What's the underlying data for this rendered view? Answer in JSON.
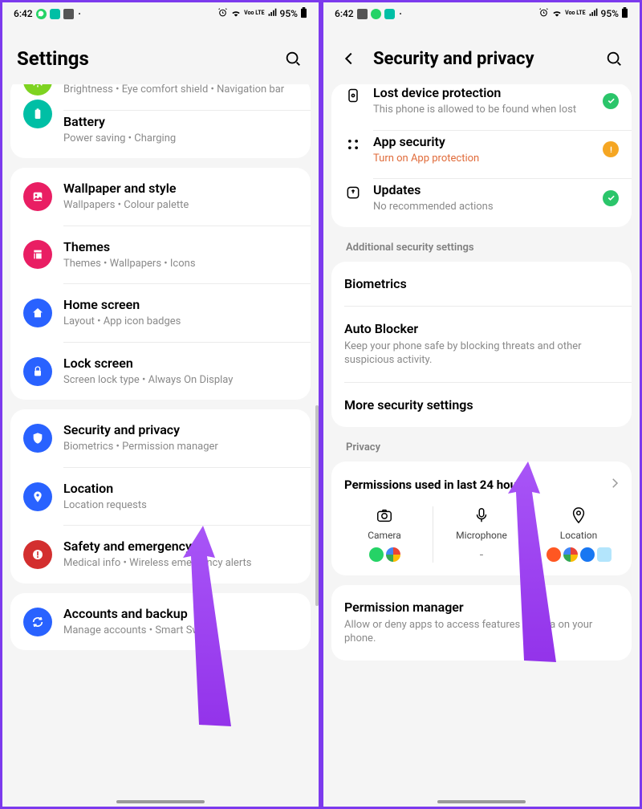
{
  "statusbar": {
    "time": "6:42",
    "battery": "95%",
    "network": "Voo LTE"
  },
  "left": {
    "header": "Settings",
    "partial": {
      "sub": "Brightness  •  Eye comfort shield  •  Navigation bar"
    },
    "card1": [
      {
        "title": "Battery",
        "sub": "Power saving  •  Charging"
      }
    ],
    "card2": [
      {
        "title": "Wallpaper and style",
        "sub": "Wallpapers  •  Colour palette"
      },
      {
        "title": "Themes",
        "sub": "Themes  •  Wallpapers  •  Icons"
      },
      {
        "title": "Home screen",
        "sub": "Layout  •  App icon badges"
      },
      {
        "title": "Lock screen",
        "sub": "Screen lock type  •  Always On Display"
      }
    ],
    "card3": [
      {
        "title": "Security and privacy",
        "sub": "Biometrics  •  Permission manager"
      },
      {
        "title": "Location",
        "sub": "Location requests"
      },
      {
        "title": "Safety and emergency",
        "sub": "Medical info  •  Wireless emergency alerts"
      }
    ],
    "card4": [
      {
        "title": "Accounts and backup",
        "sub": "Manage accounts  •  Smart Switch"
      }
    ]
  },
  "right": {
    "header": "Security and privacy",
    "card1": [
      {
        "title": "Lost device protection",
        "sub": "This phone is allowed to be found when lost",
        "status": "ok"
      },
      {
        "title": "App security",
        "sub": "Turn on App protection",
        "status": "warn",
        "subwarn": true
      },
      {
        "title": "Updates",
        "sub": "No recommended actions",
        "status": "ok"
      }
    ],
    "section1": "Additional security settings",
    "card2": [
      {
        "title": "Biometrics"
      },
      {
        "title": "Auto Blocker",
        "sub": "Keep your phone safe by blocking threats and other suspicious activity."
      },
      {
        "title": "More security settings"
      }
    ],
    "section2": "Privacy",
    "perm_title": "Permissions used in last 24 hours",
    "perm_cols": [
      {
        "label": "Camera"
      },
      {
        "label": "Microphone",
        "empty": "-"
      },
      {
        "label": "Location"
      }
    ],
    "card4": [
      {
        "title": "Permission manager",
        "sub": "Allow or deny apps to access features or data on your phone."
      }
    ]
  }
}
